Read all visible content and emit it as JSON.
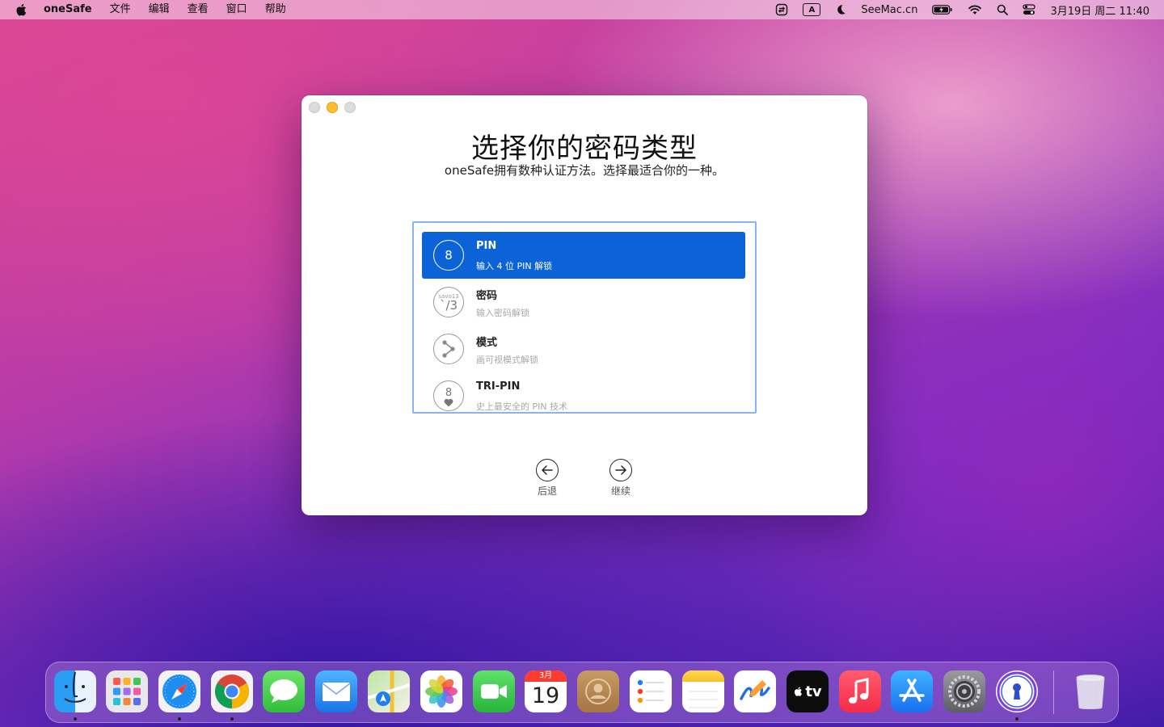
{
  "menubar": {
    "app_name": "oneSafe",
    "menus": [
      "文件",
      "编辑",
      "查看",
      "窗口",
      "帮助"
    ],
    "status": {
      "keyboard_input": "A",
      "brand": "SeeMac.cn",
      "datetime": "3月19日 周二  11:40"
    }
  },
  "window": {
    "title": "选择你的密码类型",
    "subtitle": "oneSafe拥有数种认证方法。选择最适合你的一种。",
    "options": [
      {
        "title": "PIN",
        "description": "输入 4 位 PIN 解锁",
        "icon_text": "8",
        "selected": true
      },
      {
        "title": "密码",
        "description": "输入密码解锁",
        "icon_text": "`/3",
        "icon_small": "savo13",
        "selected": false
      },
      {
        "title": "模式",
        "description": "画可视模式解锁",
        "icon_text": "",
        "selected": false
      },
      {
        "title": "TRI-PIN",
        "description": "史上最安全的 PIN 技术",
        "icon_text": "8",
        "selected": false
      }
    ],
    "back_label": "后退",
    "continue_label": "继续"
  },
  "dock": {
    "calendar": {
      "month": "3月",
      "day": "19"
    },
    "tv_label": "tv",
    "apps": [
      "finder",
      "launchpad",
      "safari",
      "chrome",
      "messages",
      "mail",
      "maps",
      "photos",
      "facetime",
      "calendar",
      "contacts",
      "reminders",
      "notes",
      "freeform",
      "apple-tv",
      "music",
      "app-store",
      "system-settings",
      "onesafe",
      "trash"
    ]
  },
  "colors": {
    "accent": "#0b63d7",
    "selection_border": "#8ab3f3",
    "traffic_min": "#febc2e"
  }
}
